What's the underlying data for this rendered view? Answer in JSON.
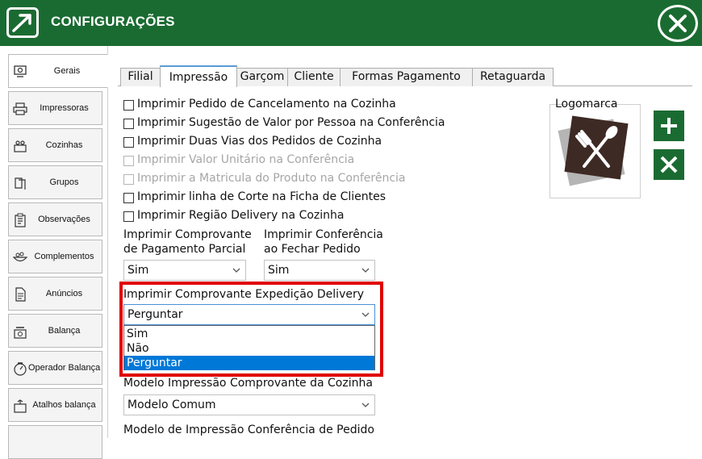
{
  "header": {
    "title": "CONFIGURAÇÕES",
    "color": "#1a6b31"
  },
  "sidebar": {
    "items": [
      {
        "label": "Gerais",
        "icon": "gear-monitor-icon",
        "active": true
      },
      {
        "label": "Impressoras",
        "icon": "printer-icon",
        "active": false
      },
      {
        "label": "Cozinhas",
        "icon": "kitchen-icon",
        "active": false
      },
      {
        "label": "Grupos",
        "icon": "groups-icon",
        "active": false
      },
      {
        "label": "Observações",
        "icon": "clipboard-icon",
        "active": false
      },
      {
        "label": "Complementos",
        "icon": "bowl-icon",
        "active": false
      },
      {
        "label": "Anúncios",
        "icon": "document-icon",
        "active": false
      },
      {
        "label": "Balança",
        "icon": "scale-icon",
        "active": false
      },
      {
        "label": "Operador Balança",
        "icon": "operator-scale-icon",
        "active": false
      },
      {
        "label": "Atalhos balança",
        "icon": "shortcut-scale-icon",
        "active": false
      }
    ]
  },
  "tabs": [
    {
      "label": "Filial",
      "active": false
    },
    {
      "label": "Impressão",
      "active": true
    },
    {
      "label": "Garçom",
      "active": false
    },
    {
      "label": "Cliente",
      "active": false
    },
    {
      "label": "Formas Pagamento",
      "active": false
    },
    {
      "label": "Retaguarda",
      "active": false
    }
  ],
  "checkboxes": [
    {
      "label": "Imprimir Pedido de Cancelamento na Cozinha",
      "checked": false,
      "enabled": true
    },
    {
      "label": "Imprimir Sugestão de Valor por Pessoa na Conferência",
      "checked": false,
      "enabled": true
    },
    {
      "label": "Imprimir Duas Vias dos Pedidos de Cozinha",
      "checked": false,
      "enabled": true
    },
    {
      "label": "Imprimir Valor Unitário na Conferência",
      "checked": false,
      "enabled": false
    },
    {
      "label": "Imprimir a Matricula do Produto na Conferência",
      "checked": false,
      "enabled": false
    },
    {
      "label": "Imprimir linha de Corte na Ficha de Clientes",
      "checked": false,
      "enabled": true
    },
    {
      "label": "Imprimir Região Delivery na Cozinha",
      "checked": false,
      "enabled": true
    }
  ],
  "fields": {
    "pagamento_parcial": {
      "label_line1": "Imprimir Comprovante",
      "label_line2": "de Pagamento Parcial",
      "value": "Sim"
    },
    "conferencia_fechar": {
      "label_line1": "Imprimir Conferência",
      "label_line2": "ao Fechar Pedido",
      "value": "Sim"
    },
    "expedicao_delivery": {
      "label": "Imprimir Comprovante Expedição Delivery",
      "value": "Perguntar",
      "options": [
        "Sim",
        "Não",
        "Perguntar"
      ],
      "highlighted_option": "Perguntar"
    },
    "modelo_cozinha": {
      "label": "Modelo Impressão Comprovante da Cozinha",
      "value": "Modelo Comum"
    },
    "modelo_conferencia": {
      "label": "Modelo de Impressão Conferência de Pedido"
    }
  },
  "logo": {
    "label": "Logomarca",
    "icon": "fork-spoon-icon"
  },
  "actions": {
    "add_icon": "plus-icon",
    "remove_icon": "x-icon"
  },
  "colors": {
    "highlight": "#e00000",
    "selection": "#0078d7",
    "brand": "#1a6b31"
  }
}
